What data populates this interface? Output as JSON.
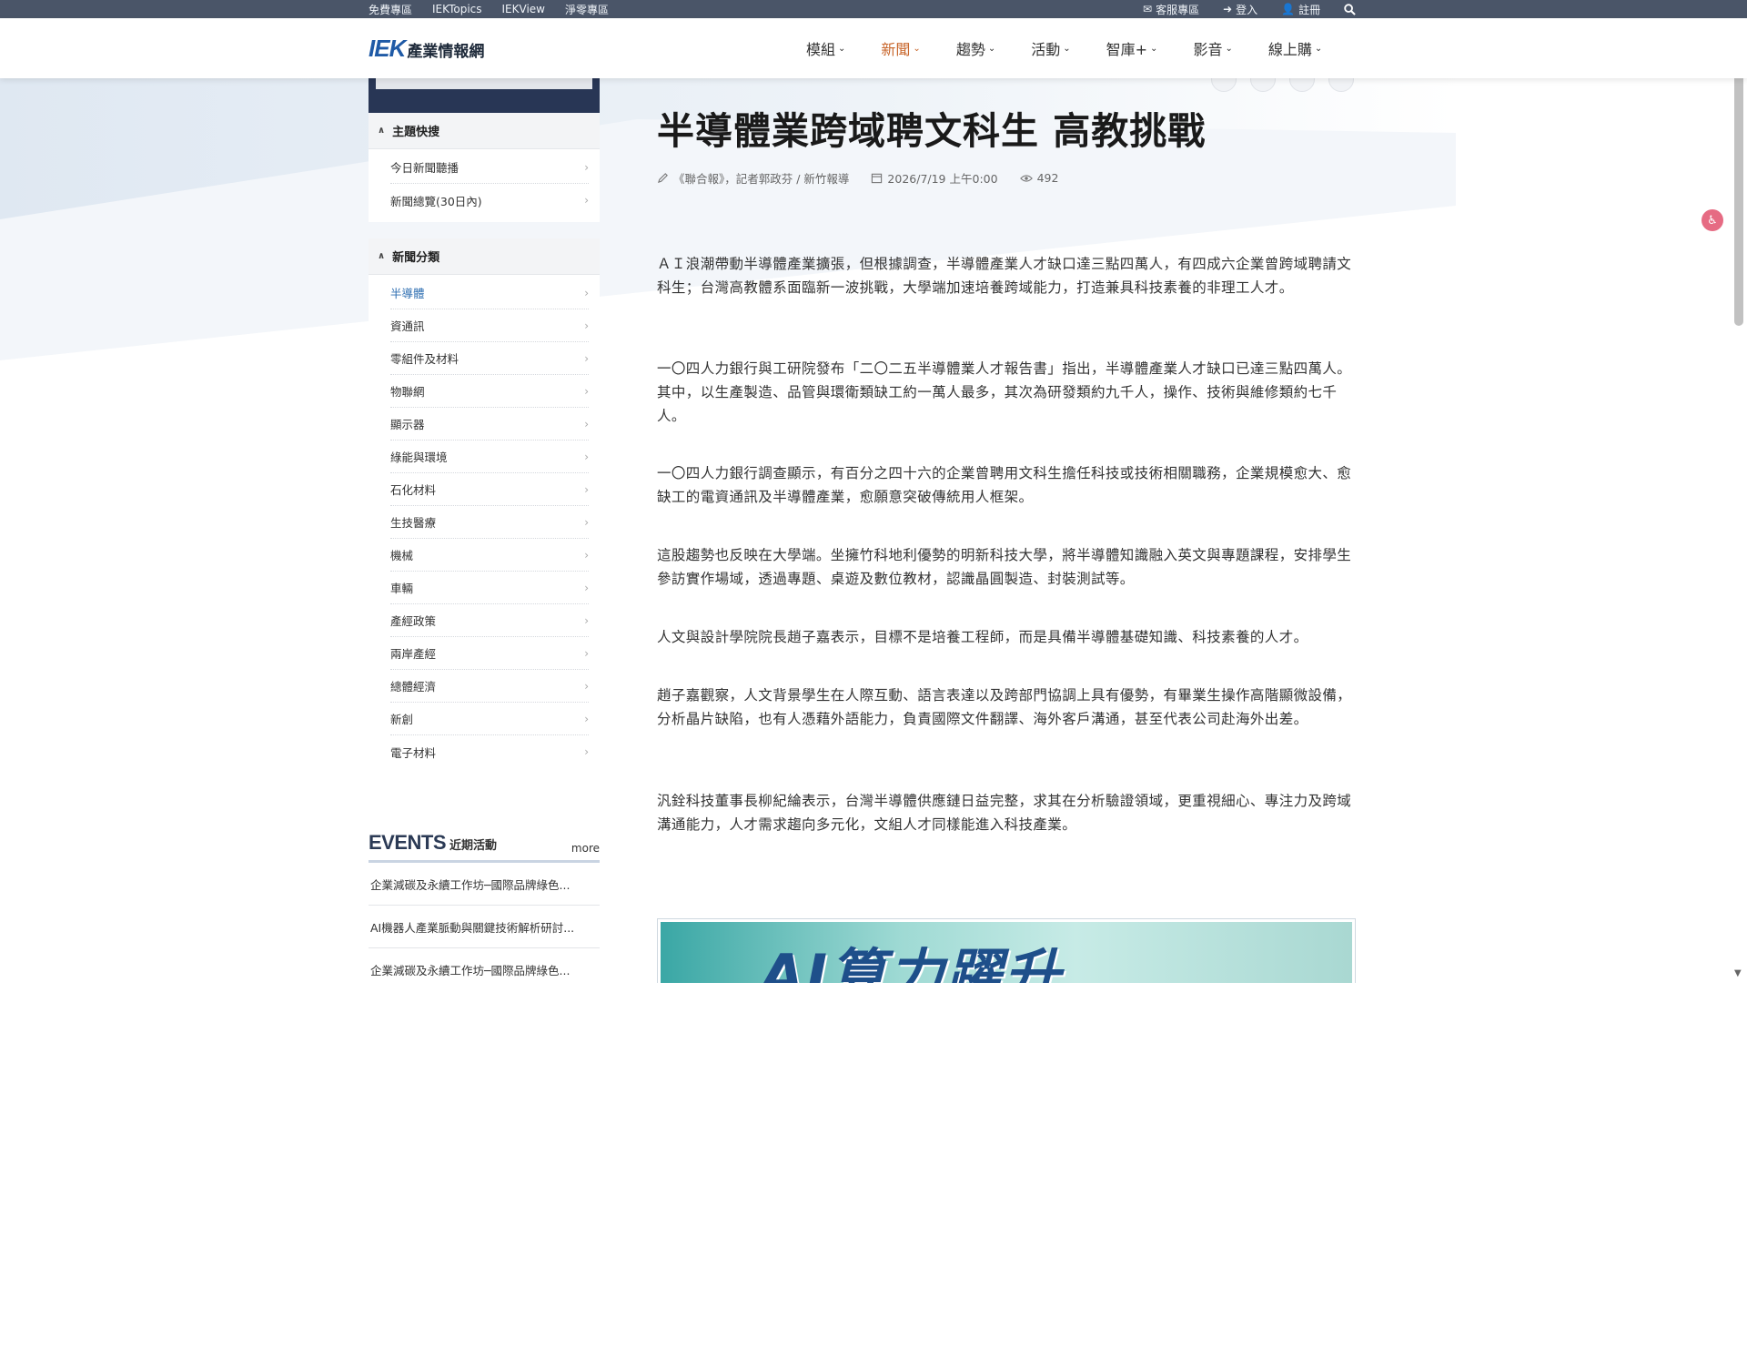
{
  "topbar": {
    "left_links": [
      "免費專區",
      "IEKTopics",
      "IEKView",
      "淨零專區"
    ],
    "service": "客服專區",
    "login": "登入",
    "register": "註冊"
  },
  "header": {
    "logo_mark": "IEK",
    "logo_text": "產業情報網",
    "nav": [
      {
        "label": "模組",
        "active": false
      },
      {
        "label": "新聞",
        "active": true
      },
      {
        "label": "趨勢",
        "active": false
      },
      {
        "label": "活動",
        "active": false
      },
      {
        "label": "智庫+",
        "active": false
      },
      {
        "label": "影音",
        "active": false
      },
      {
        "label": "線上購",
        "active": false
      }
    ]
  },
  "sidebar": {
    "topics": {
      "heading": "主題快搜",
      "items": [
        "今日新聞聽播",
        "新聞總覽(30日內)"
      ]
    },
    "categories": {
      "heading": "新聞分類",
      "active_index": 0,
      "items": [
        "半導體",
        "資通訊",
        "零組件及材料",
        "物聯網",
        "顯示器",
        "綠能與環境",
        "石化材料",
        "生技醫療",
        "機械",
        "車輛",
        "產經政策",
        "兩岸產經",
        "總體經濟",
        "新創",
        "電子材料"
      ]
    }
  },
  "events": {
    "title_en": "EVENTS",
    "title_zh": "近期活動",
    "more": "more",
    "items": [
      "企業減碳及永續工作坊─國際品牌綠色...",
      "AI機器人產業脈動與關鍵技術解析研討...",
      "企業減碳及永續工作坊─國際品牌綠色..."
    ]
  },
  "article": {
    "title": "半導體業跨域聘文科生 高教挑戰",
    "source": "《聯合報》，記者郭政芬 / 新竹報導",
    "date": "2026/7/19 上午0:00",
    "views": "492",
    "paragraphs": [
      "ＡＩ浪潮帶動半導體產業擴張，但根據調查，半導體產業人才缺口達三點四萬人，有四成六企業曾跨域聘請文科生；台灣高教體系面臨新一波挑戰，大學端加速培養跨域能力，打造兼具科技素養的非理工人才。",
      "一〇四人力銀行與工研院發布「二〇二五半導體業人才報告書」指出，半導體產業人才缺口已達三點四萬人。其中，以生產製造、品管與環衛類缺工約一萬人最多，其次為研發類約九千人，操作、技術與維修類約七千人。",
      "一〇四人力銀行調查顯示，有百分之四十六的企業曾聘用文科生擔任科技或技術相關職務，企業規模愈大、愈缺工的電資通訊及半導體產業，愈願意突破傳統用人框架。",
      "這股趨勢也反映在大學端。坐擁竹科地利優勢的明新科技大學，將半導體知識融入英文與專題課程，安排學生參訪實作場域，透過專題、桌遊及數位教材，認識晶圓製造、封裝測試等。",
      "人文與設計學院院長趙子嘉表示，目標不是培養工程師，而是具備半導體基礎知識、科技素養的人才。",
      "趙子嘉觀察，人文背景學生在人際互動、語言表達以及跨部門協調上具有優勢，有畢業生操作高階顯微設備，分析晶片缺陷，也有人憑藉外語能力，負責國際文件翻譯、海外客戶溝通，甚至代表公司赴海外出差。",
      "汎銓科技董事長柳紀綸表示，台灣半導體供應鏈日益完整，求其在分析驗證領域，更重視細心、專注力及跨域溝通能力，人才需求趨向多元化，文組人才同樣能進入科技產業。"
    ],
    "banner_text": "AI算力躍升"
  }
}
